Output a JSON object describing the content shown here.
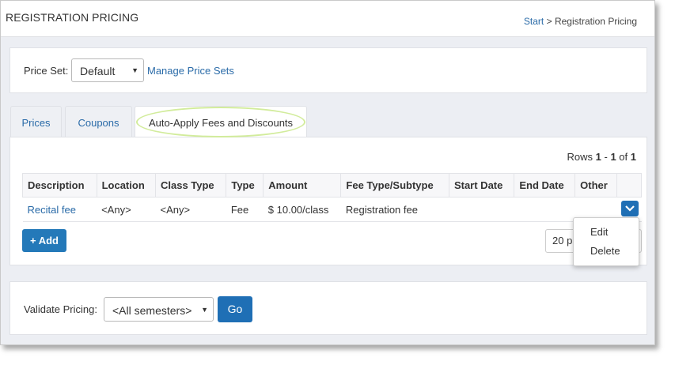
{
  "header": {
    "title": "REGISTRATION PRICING"
  },
  "breadcrumb": {
    "start": "Start",
    "separator": " > ",
    "current": "Registration Pricing"
  },
  "price_set": {
    "label": "Price Set:",
    "value": "Default",
    "manage_link": "Manage Price Sets"
  },
  "tabs": [
    {
      "label": "Prices",
      "active": false
    },
    {
      "label": "Coupons",
      "active": false
    },
    {
      "label": "Auto-Apply Fees and Discounts",
      "active": true
    }
  ],
  "rows_info": {
    "prefix": "Rows ",
    "start": "1",
    "dash": " - ",
    "end": "1",
    "of": " of ",
    "total": "1"
  },
  "table": {
    "columns": [
      "Description",
      "Location",
      "Class Type",
      "Type",
      "Amount",
      "Fee Type/Subtype",
      "Start Date",
      "End Date",
      "Other"
    ],
    "rows": [
      {
        "description": "Recital fee",
        "location": "<Any>",
        "class_type": "<Any>",
        "type": "Fee",
        "amount": "$ 10.00/class",
        "fee_type": "Registration fee",
        "start_date": "",
        "end_date": "",
        "other": ""
      }
    ]
  },
  "add_button": {
    "icon": "+",
    "label": "Add"
  },
  "per_page": {
    "value": "20 p"
  },
  "row_menu": {
    "items": [
      "Edit",
      "Delete"
    ]
  },
  "validate": {
    "label": "Validate Pricing:",
    "select_value": "<All semesters>",
    "go_label": "Go"
  },
  "colors": {
    "accent": "#1f6fb5",
    "link": "#2a6ba8",
    "highlight": "#d2ec9c",
    "background": "#eceef3"
  },
  "icons": {
    "row_menu": "chevron-down-icon",
    "select": "caret-down-icon",
    "add": "plus-icon"
  }
}
